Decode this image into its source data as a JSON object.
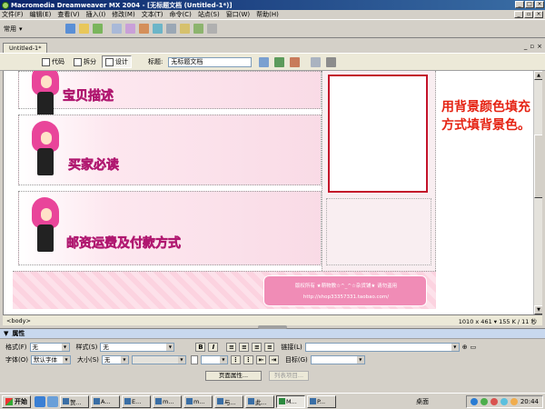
{
  "window": {
    "title": "Macromedia Dreamweaver MX 2004 - [无标题文档 (Untitled-1*)]",
    "controls": [
      "_",
      "□",
      "×"
    ]
  },
  "menu": [
    "文件(F)",
    "编辑(E)",
    "查看(V)",
    "插入(I)",
    "修改(M)",
    "文本(T)",
    "命令(C)",
    "站点(S)",
    "窗口(W)",
    "帮助(H)"
  ],
  "mdi_controls": [
    "_",
    "▫",
    "×"
  ],
  "insert_bar": {
    "category": "常用"
  },
  "document": {
    "tab": "Untitled-1*",
    "views": {
      "code": "代码",
      "split": "拆分",
      "design": "设计"
    },
    "title_label": "标题:",
    "title_value": "无标题文档"
  },
  "canvas": {
    "sections": [
      "宝贝描述",
      "买家必读",
      "邮资运费及付款方式"
    ],
    "note": "用背景颜色填充方式填背景色。",
    "footer_line1": "版权所有    ★萌物教☆^_^☆杂货铺★    请勿盗用",
    "footer_line2": "http://shop33357331.taobao.com/"
  },
  "status": {
    "tag": "<body>",
    "size": "1010 x 461 ▾ 155 K / 11 秒"
  },
  "properties": {
    "panel_title": "属性",
    "format_label": "格式(F)",
    "format_value": "无",
    "style_label": "样式(S)",
    "style_value": "无",
    "link_label": "链接(L)",
    "font_label": "字体(O)",
    "font_value": "默认字体",
    "size_label": "大小(S)",
    "size_value": "无",
    "target_label": "目标(G)",
    "page_props_button": "页面属性...",
    "list_item_button": "列表项目..."
  },
  "taskbar": {
    "start": "开始",
    "tasks": [
      "贺...",
      "A...",
      "E...",
      "m...",
      "m...",
      "与...",
      "此...",
      "M...",
      "P..."
    ],
    "desktop_label": "桌面",
    "clock": "20:44"
  },
  "colors": {
    "title_gradient_start": "#0a246a",
    "section_label": "#ff5ab4",
    "note_text": "#e52313",
    "red_box_border": "#c3132a"
  }
}
